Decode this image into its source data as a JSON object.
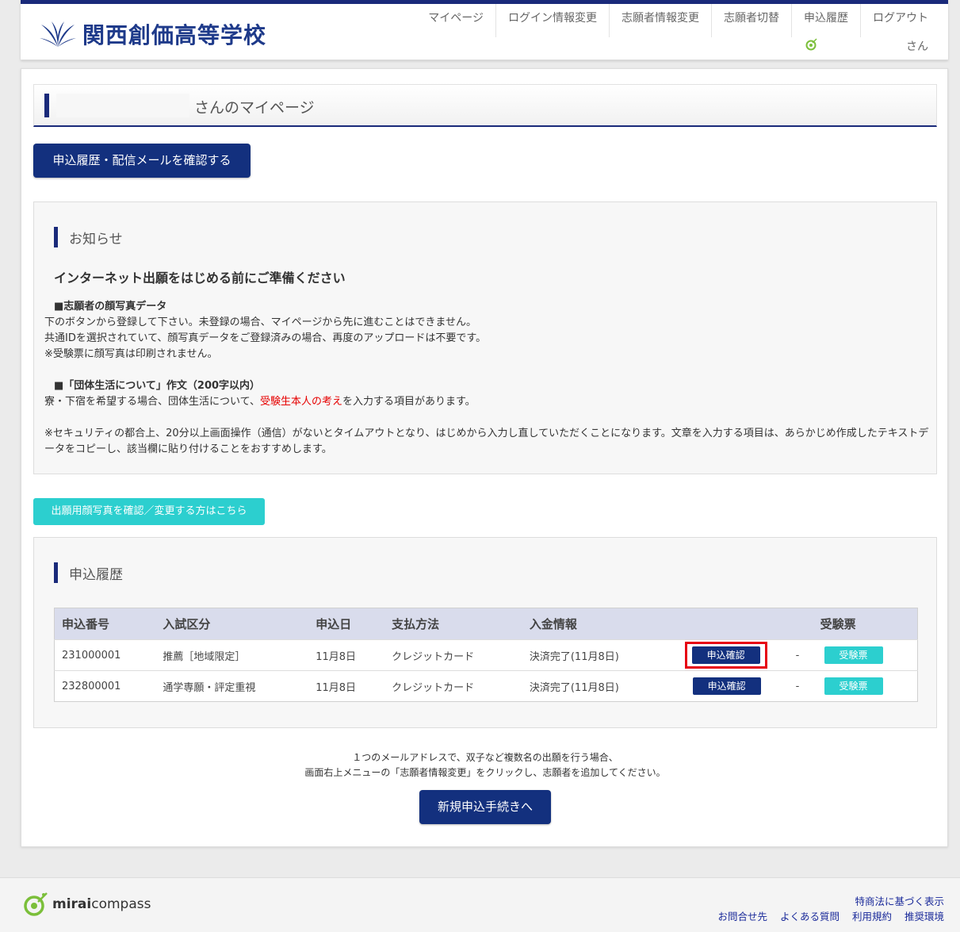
{
  "header": {
    "school_name": "関西創価高等学校",
    "user_suffix": "さん",
    "nav": [
      "マイページ",
      "ログイン情報変更",
      "志願者情報変更",
      "志願者切替",
      "申込履歴",
      "ログアウト"
    ]
  },
  "page": {
    "title_suffix": "さんのマイページ",
    "history_button": "申込履歴・配信メールを確認する"
  },
  "notice": {
    "heading": "お知らせ",
    "title": "インターネット出願をはじめる前にご準備ください",
    "photo_head": "■志願者の顔写真データ",
    "photo_lines": [
      "下のボタンから登録して下さい。未登録の場合、マイページから先に進むことはできません。",
      "共通IDを選択されていて、顔写真データをご登録済みの場合、再度のアップロードは不要です。",
      "※受験票に顔写真は印刷されません。"
    ],
    "essay_head": "■「団体生活について」作文（200字以内）",
    "essay_pre": "寮・下宿を希望する場合、団体生活について、",
    "essay_red": "受験生本人の考え",
    "essay_post": "を入力する項目があります。",
    "security_note": "※セキュリティの都合上、20分以上画面操作（通信）がないとタイムアウトとなり、はじめから入力し直していただくことになります。文章を入力する項目は、あらかじめ作成したテキストデータをコピーし、該当欄に貼り付けることをおすすめします。"
  },
  "photo_button": "出願用顔写真を確認／変更する方はこちら",
  "history": {
    "heading": "申込履歴",
    "columns": [
      "申込番号",
      "入試区分",
      "申込日",
      "支払方法",
      "入金情報",
      "",
      "受験票"
    ],
    "rows": [
      {
        "number": "231000001",
        "category": "推薦［地域限定］",
        "date": "11月8日",
        "payment": "クレジットカード",
        "status": "決済完了(11月8日)",
        "confirm": "申込確認",
        "dash": "-",
        "ticket": "受験票"
      },
      {
        "number": "232800001",
        "category": "通学専願・評定重視",
        "date": "11月8日",
        "payment": "クレジットカード",
        "status": "決済完了(11月8日)",
        "confirm": "申込確認",
        "dash": "-",
        "ticket": "受験票"
      }
    ]
  },
  "bottom": {
    "line1": "１つのメールアドレスで、双子など複数名の出願を行う場合、",
    "line2": "画面右上メニューの「志願者情報変更」をクリックし、志願者を追加してください。",
    "new_button": "新規申込手続きへ"
  },
  "footer": {
    "brand_bold": "mirai",
    "brand_rest": "compass",
    "link_top": "特商法に基づく表示",
    "links": [
      "お問合せ先",
      "よくある質問",
      "利用規約",
      "推奨環境"
    ]
  },
  "colors": {
    "navy": "#13307e",
    "teal": "#2ccfcf",
    "highlight": "#e60012"
  }
}
